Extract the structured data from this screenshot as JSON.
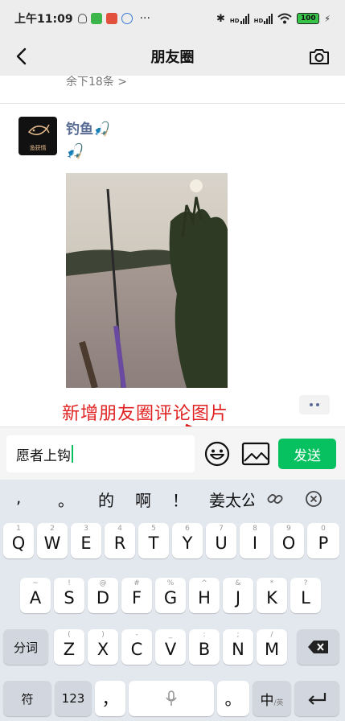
{
  "status_bar": {
    "time": "上午11:09",
    "more": "···",
    "battery": "100",
    "signal1": "HD",
    "signal2": "HD"
  },
  "nav": {
    "title": "朋友圈"
  },
  "feed": {
    "rest_text": "余下18条 >",
    "post": {
      "username": "钓鱼🎣",
      "text": "🎣",
      "avatar_text": "渔获情"
    },
    "annotation": "新增朋友圈评论图片"
  },
  "comment": {
    "value": "愿者上钩",
    "send_label": "发送"
  },
  "keyboard": {
    "candidates": [
      ",",
      "。",
      "的",
      "啊",
      "！",
      "姜太公"
    ],
    "row1": [
      {
        "key": "Q",
        "hint": "1"
      },
      {
        "key": "W",
        "hint": "2"
      },
      {
        "key": "E",
        "hint": "3"
      },
      {
        "key": "R",
        "hint": "4"
      },
      {
        "key": "T",
        "hint": "5"
      },
      {
        "key": "Y",
        "hint": "6"
      },
      {
        "key": "U",
        "hint": "7"
      },
      {
        "key": "I",
        "hint": "8"
      },
      {
        "key": "O",
        "hint": "9"
      },
      {
        "key": "P",
        "hint": "0"
      }
    ],
    "row2": [
      {
        "key": "A",
        "hint": "~"
      },
      {
        "key": "S",
        "hint": "!"
      },
      {
        "key": "D",
        "hint": "@"
      },
      {
        "key": "F",
        "hint": "#"
      },
      {
        "key": "G",
        "hint": "%"
      },
      {
        "key": "H",
        "hint": "^"
      },
      {
        "key": "J",
        "hint": "&"
      },
      {
        "key": "K",
        "hint": "*"
      },
      {
        "key": "L",
        "hint": "?"
      }
    ],
    "row3": [
      {
        "key": "Z",
        "hint": "("
      },
      {
        "key": "X",
        "hint": ")"
      },
      {
        "key": "C",
        "hint": "-"
      },
      {
        "key": "V",
        "hint": "_"
      },
      {
        "key": "B",
        "hint": ":"
      },
      {
        "key": "N",
        "hint": ";"
      },
      {
        "key": "M",
        "hint": "/"
      }
    ],
    "fenci_label": "分词",
    "symbol_label": "符",
    "num_label": "123",
    "comma_label": "，",
    "period_label": "。",
    "lang_label": "中",
    "lang_sub": "/英"
  },
  "colors": {
    "accent": "#07c160",
    "link": "#576b95",
    "annotation": "#e02020"
  }
}
